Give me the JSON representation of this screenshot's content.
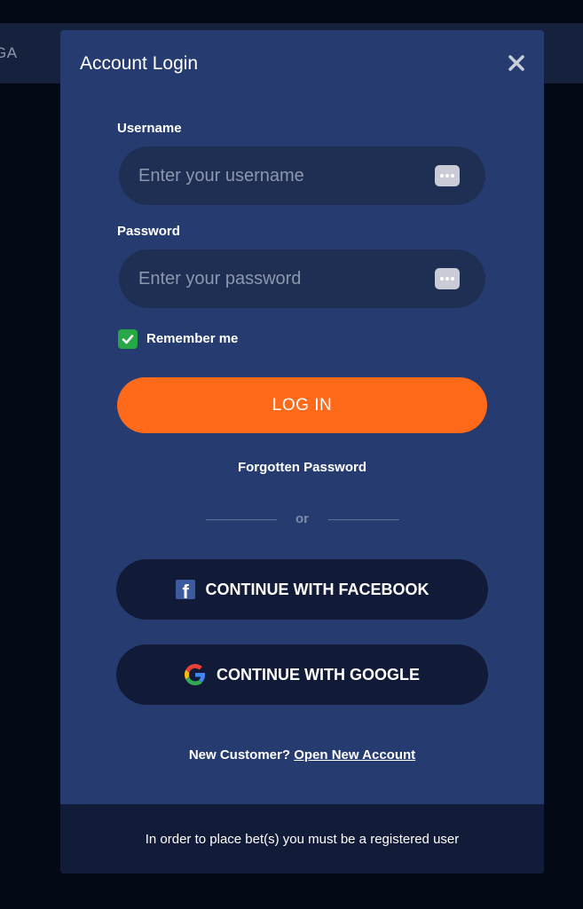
{
  "background": {
    "bar_text": "GA"
  },
  "modal": {
    "title": "Account Login",
    "close_icon": "close-icon"
  },
  "username": {
    "label": "Username",
    "placeholder": "Enter your username",
    "value": ""
  },
  "password": {
    "label": "Password",
    "placeholder": "Enter your password",
    "value": ""
  },
  "remember": {
    "label": "Remember me",
    "checked": true
  },
  "login_button": {
    "label": "LOG IN"
  },
  "forgot_password": "Forgotten Password",
  "divider_text": "or",
  "social": {
    "facebook_label": "CONTINUE WITH FACEBOOK",
    "google_label": "CONTINUE WITH GOOGLE"
  },
  "register": {
    "prompt": "New Customer?",
    "link": "Open New Account"
  },
  "footer": {
    "notice": "In order to place bet(s) you must be a registered user"
  },
  "colors": {
    "modal_bg": "#263c70",
    "input_bg": "#1f2e53",
    "accent": "#ff6a1a",
    "social_bg": "#111a36",
    "checkbox": "#27a745"
  }
}
